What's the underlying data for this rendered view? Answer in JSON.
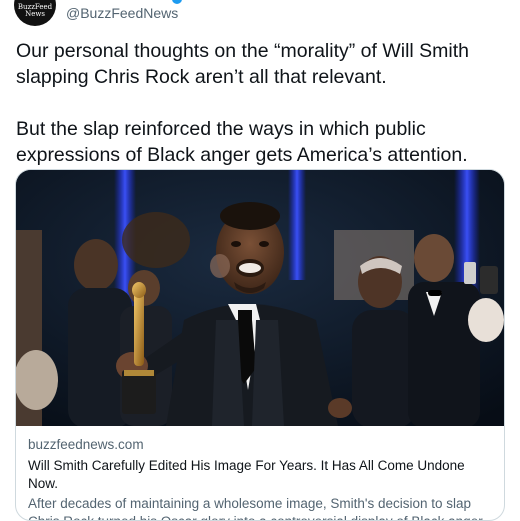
{
  "account": {
    "avatar_text": "BuzzFeed News",
    "handle": "@BuzzFeedNews"
  },
  "tweet": {
    "paragraph_1": "Our personal thoughts on the “morality” of Will Smith slapping Chris Rock aren’t all that relevant.",
    "paragraph_2": "But the slap reinforced the ways in which public expressions of Black anger gets America’s attention."
  },
  "link_card": {
    "image_subject": "photo of Will Smith holding an Oscar statuette at a party",
    "domain": "buzzfeednews.com",
    "title": "Will Smith Carefully Edited His Image For Years. It Has All Come Undone Now.",
    "description": "After decades of maintaining a wholesome image, Smith's decision to slap Chris Rock turned his Oscar glory into a controversial display of Black anger."
  },
  "colors": {
    "text": "#0f1419",
    "secondary_text": "#536471",
    "border": "#cfd9de",
    "verified": "#1d9bf0"
  }
}
